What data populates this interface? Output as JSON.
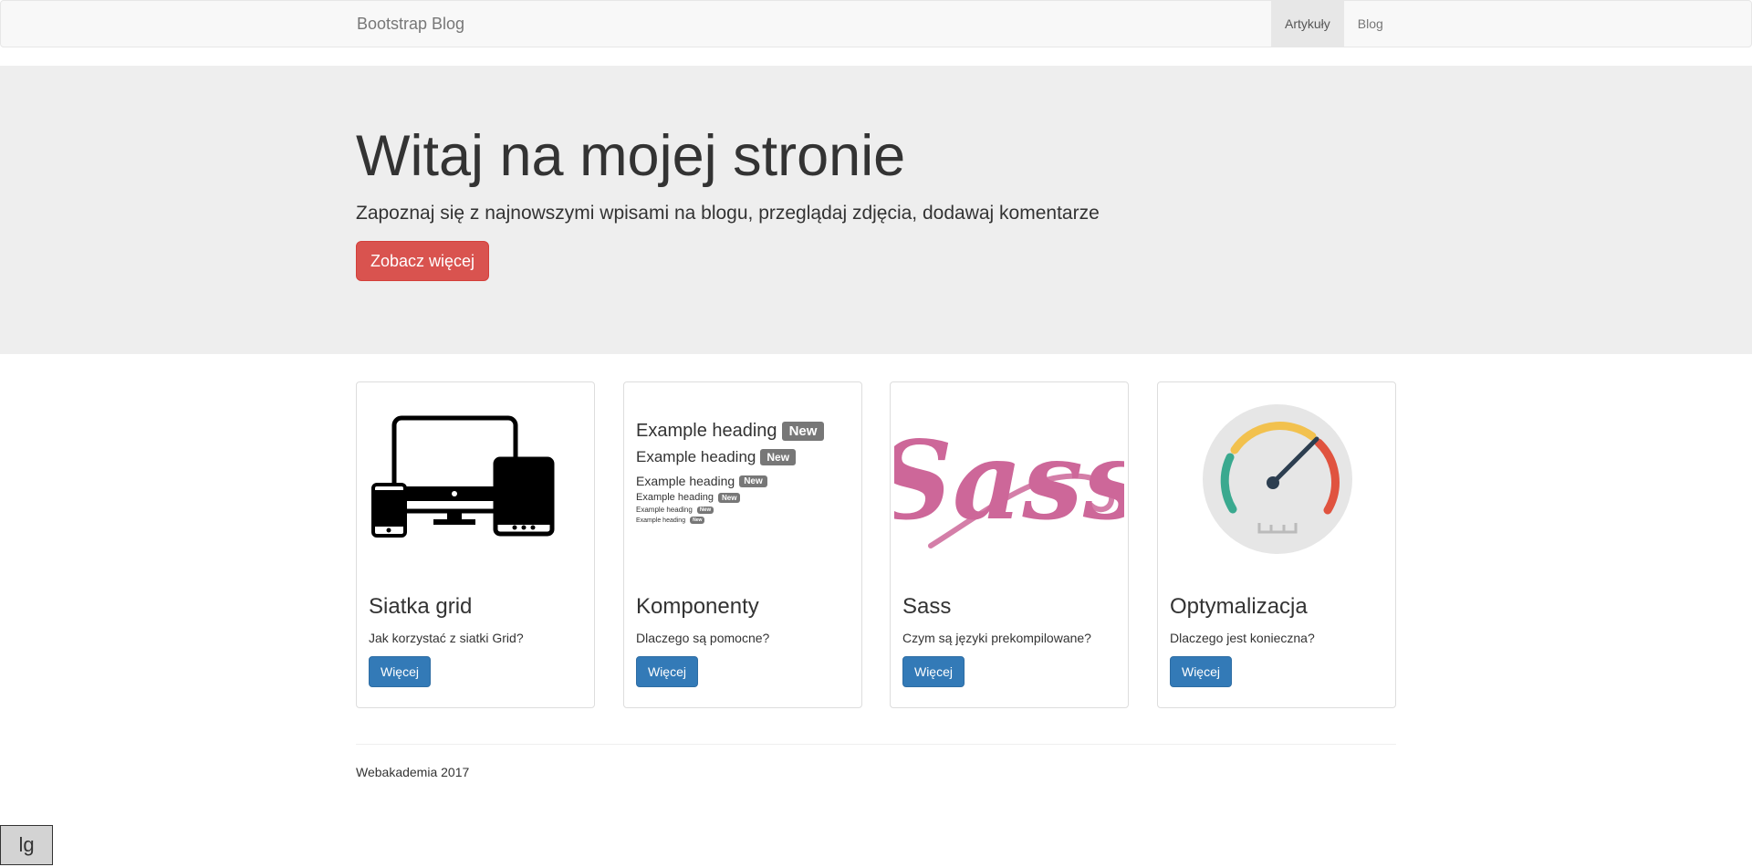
{
  "navbar": {
    "brand": "Bootstrap Blog",
    "items": [
      {
        "label": "Artykuły",
        "active": true
      },
      {
        "label": "Blog",
        "active": false
      }
    ]
  },
  "jumbotron": {
    "title": "Witaj na mojej stronie",
    "lead": "Zapoznaj się z najnowszymi wpisami na blogu, przeglądaj zdjęcia, dodawaj komentarze",
    "button": "Zobacz więcej",
    "button_color": "#d9534f"
  },
  "cards": [
    {
      "title": "Siatka grid",
      "text": "Jak korzystać z siatki Grid?",
      "button": "Więcej",
      "icon": "responsive-devices-icon"
    },
    {
      "title": "Komponenty",
      "text": "Dlaczego są pomocne?",
      "button": "Więcej",
      "icon": "headings-badges-illustration",
      "headings": [
        {
          "text": "Example heading",
          "badge": "New"
        },
        {
          "text": "Example heading",
          "badge": "New"
        },
        {
          "text": "Example heading",
          "badge": "New"
        },
        {
          "text": "Example heading",
          "badge": "New"
        },
        {
          "text": "Example heading",
          "badge": "New"
        },
        {
          "text": "Example heading",
          "badge": "New"
        }
      ]
    },
    {
      "title": "Sass",
      "text": "Czym są języki prekompilowane?",
      "button": "Więcej",
      "icon": "sass-logo",
      "logo_text": "Sass",
      "logo_color": "#cd6799"
    },
    {
      "title": "Optymalizacja",
      "text": "Dlaczego jest konieczna?",
      "button": "Więcej",
      "icon": "speedometer-icon"
    }
  ],
  "primary_color": "#337ab7",
  "footer": {
    "text": "Webakademia 2017"
  },
  "breakpoint_indicator": "lg"
}
